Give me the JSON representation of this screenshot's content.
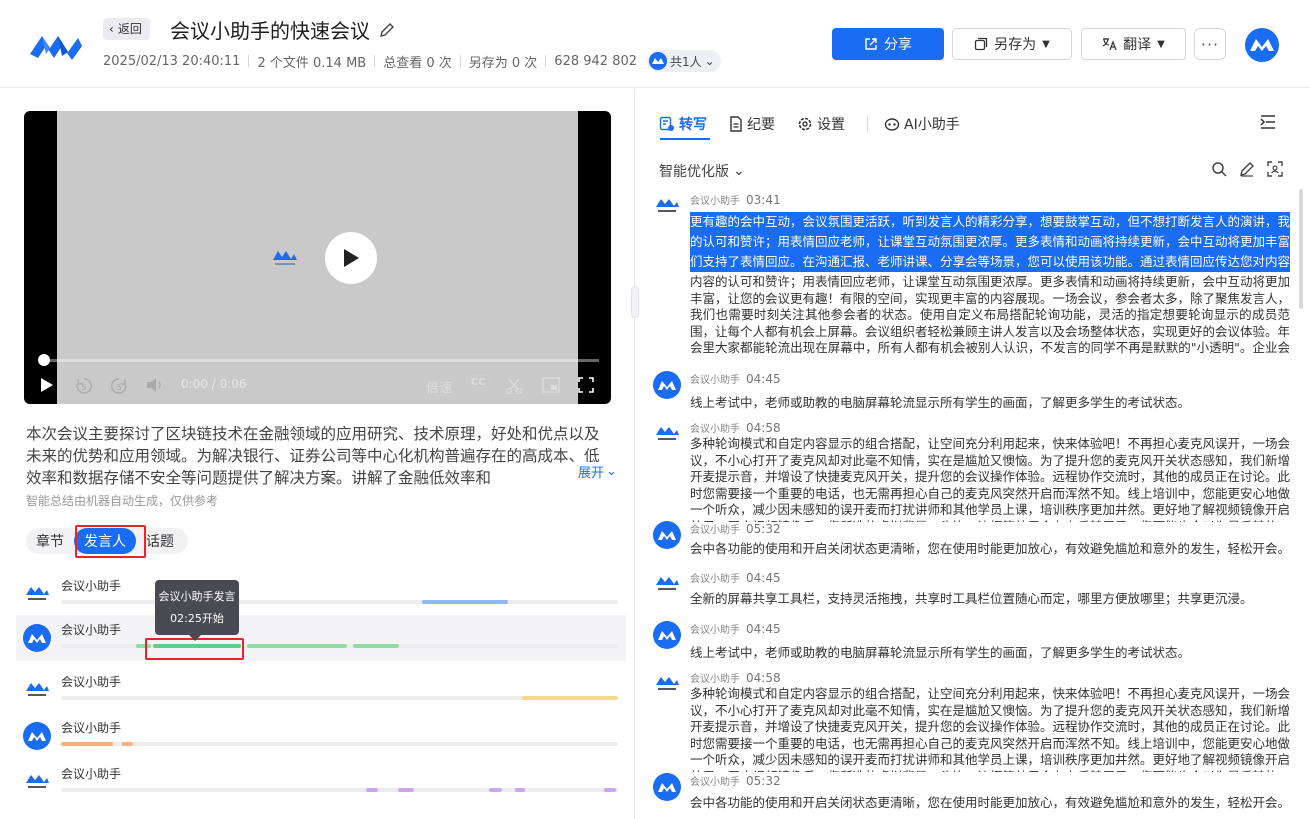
{
  "header": {
    "back_label": "返回",
    "title": "会议小助手的快速会议",
    "date": "2025/02/13 20:40:11",
    "files": "2 个文件 0.14 MB",
    "views": "总查看 0 次",
    "saves": "另存为 0 次",
    "meeting_id": "628 942 802",
    "share_count": "共1人",
    "share_btn": "分享",
    "saveas_btn": "另存为",
    "translate_btn": "翻译",
    "more_btn": "···"
  },
  "video": {
    "time": "0:00 / 0:06",
    "speed": "倍速",
    "cc": "CC",
    "progress": 0
  },
  "summary": {
    "text": "本次会议主要探讨了区块链技术在金融领域的应用研究、技术原理，好处和优点以及未来的优势和应用领域。为解决银行、证券公司等中心化机构普遍存在的高成本、低效率和数据存储不安全等问题提供了解决方案。讲解了金融低效率和",
    "expand": "展开",
    "note": "智能总结由机器自动生成，仅供参考"
  },
  "tabs": {
    "chapter": "章节",
    "speaker": "发言人",
    "topic": "话题"
  },
  "speakers": [
    {
      "name": "会议小助手"
    },
    {
      "name": "会议小助手"
    },
    {
      "name": "会议小助手"
    },
    {
      "name": "会议小助手"
    },
    {
      "name": "会议小助手"
    }
  ],
  "tooltip": {
    "title": "会议小助手发言",
    "start": "02:25开始"
  },
  "right": {
    "tab_transcript": "转写",
    "tab_minutes": "纪要",
    "tab_settings": "设置",
    "tab_ai": "AI小助手",
    "version": "智能优化版",
    "entries": [
      {
        "speaker": "会议小助手",
        "time": "03:41",
        "highlight": [
          "更有趣的会中互动，会议氛围更活跃，听到发言人的精彩分享，想要鼓掌互动，但不想打断发言人的演讲，我",
          "的认可和赞许；用表情回应老师，让课堂互动氛围更浓厚。更多表情和动画将持续更新，会中互动将更加丰富",
          "们支持了表情回应。在沟通汇报、老师讲课、分享会等场景，您可以使用该功能。通过表情回应传达您对内容"
        ],
        "text": "内容的认可和赞许；用表情回应老师，让课堂互动氛围更浓厚。更多表情和动画将持续更新，会中互动将更加丰富，让您的会议更有趣！有限的空间，实现更丰富的内容展现。一场会议，参会者太多，除了聚焦发言人，我们也需要时刻关注其他参会者的状态。使用自定义布局搭配轮询功能，灵活的指定想要轮询显示的成员范围，让每个人都有机会上屏幕。会议组织者轻松兼顾主讲人发言以及会场整体状态，实现更好的会议体验。年会里大家都能轮流出现在屏幕中，所有人都有机会被别人认识，不发言的同学不再是默默的\"小透明\"。企业会议中，无需在会中调整布局和视频聚焦，企业领导们都能轮流出镜，让会议变得更加正式而有序，规范。"
      },
      {
        "speaker": "会议小助手",
        "time": "04:45",
        "text": "线上考试中，老师或助教的电脑屏幕轮流显示所有学生的画面，了解更多学生的考试状态。"
      },
      {
        "speaker": "会议小助手",
        "time": "04:58",
        "text": "多种轮询模式和自定内容显示的组合搭配，让空间充分利用起来，快来体验吧！不再担心麦克风误开，一场会议，不小心打开了麦克风却对此毫不知情，实在是尴尬又懊恼。为了提升您的麦克风开关状态感知，我们新增开麦提示音，并增设了快捷麦克风开关，提升您的会议操作体验。远程协作交流时，其他的成员正在讨论。此时您需要接一个重要的电话，也无需再担心自己的麦克风突然开启而浑然不知。线上培训中，您能更安心地做一个听众，减少因未感知的误开麦而打扰讲师和其他学员上课，培训秩序更加井然。更好地了解视频镜像开启效果。开启视频镜像后，您所选的虚拟背景、头饰、边框等效果会左右反转展示，您可能也会以为是反转的。"
      },
      {
        "speaker": "会议小助手",
        "time": "05:32",
        "text": "会中各功能的使用和开启关闭状态更清晰，您在使用时能更加放心，有效避免尴尬和意外的发生，轻松开会。"
      },
      {
        "speaker": "会议小助手",
        "time": "04:45",
        "text": "全新的屏幕共享工具栏，支持灵活拖拽，共享时工具栏位置随心而定，哪里方便放哪里；共享更沉浸。"
      },
      {
        "speaker": "会议小助手",
        "time": "04:45",
        "text": "线上考试中，老师或助教的电脑屏幕轮流显示所有学生的画面，了解更多学生的考试状态。"
      },
      {
        "speaker": "会议小助手",
        "time": "04:58",
        "text": "多种轮询模式和自定内容显示的组合搭配，让空间充分利用起来，快来体验吧！不再担心麦克风误开，一场会议，不小心打开了麦克风却对此毫不知情，实在是尴尬又懊恼。为了提升您的麦克风开关状态感知，我们新增开麦提示音，并增设了快捷麦克风开关，提升您的会议操作体验。远程协作交流时，其他的成员正在讨论。此时您需要接一个重要的电话，也无需再担心自己的麦克风突然开启而浑然不知。线上培训中，您能更安心地做一个听众，减少因未感知的误开麦而打扰讲师和其他学员上课，培训秩序更加井然。更好地了解视频镜像开启效果。开启视频镜像后，您所选的虚拟背景、头饰、边框等效果会左右反转展示，您可能也会以为是反转的。"
      },
      {
        "speaker": "会议小助手",
        "time": "05:32",
        "text": "会中各功能的使用和开启关闭状态更清晰，您在使用时能更加放心，有效避免尴尬和意外的发生，轻松开会。"
      }
    ]
  },
  "colors": {
    "accent": "#1a6cf2",
    "highlight_box": "#e5252a",
    "seg_blue": "#8fb7f2",
    "seg_green": "#8fdca6",
    "seg_yellow": "#f4d98a",
    "seg_orange": "#f5b07c",
    "seg_purple": "#c9a6ee"
  }
}
